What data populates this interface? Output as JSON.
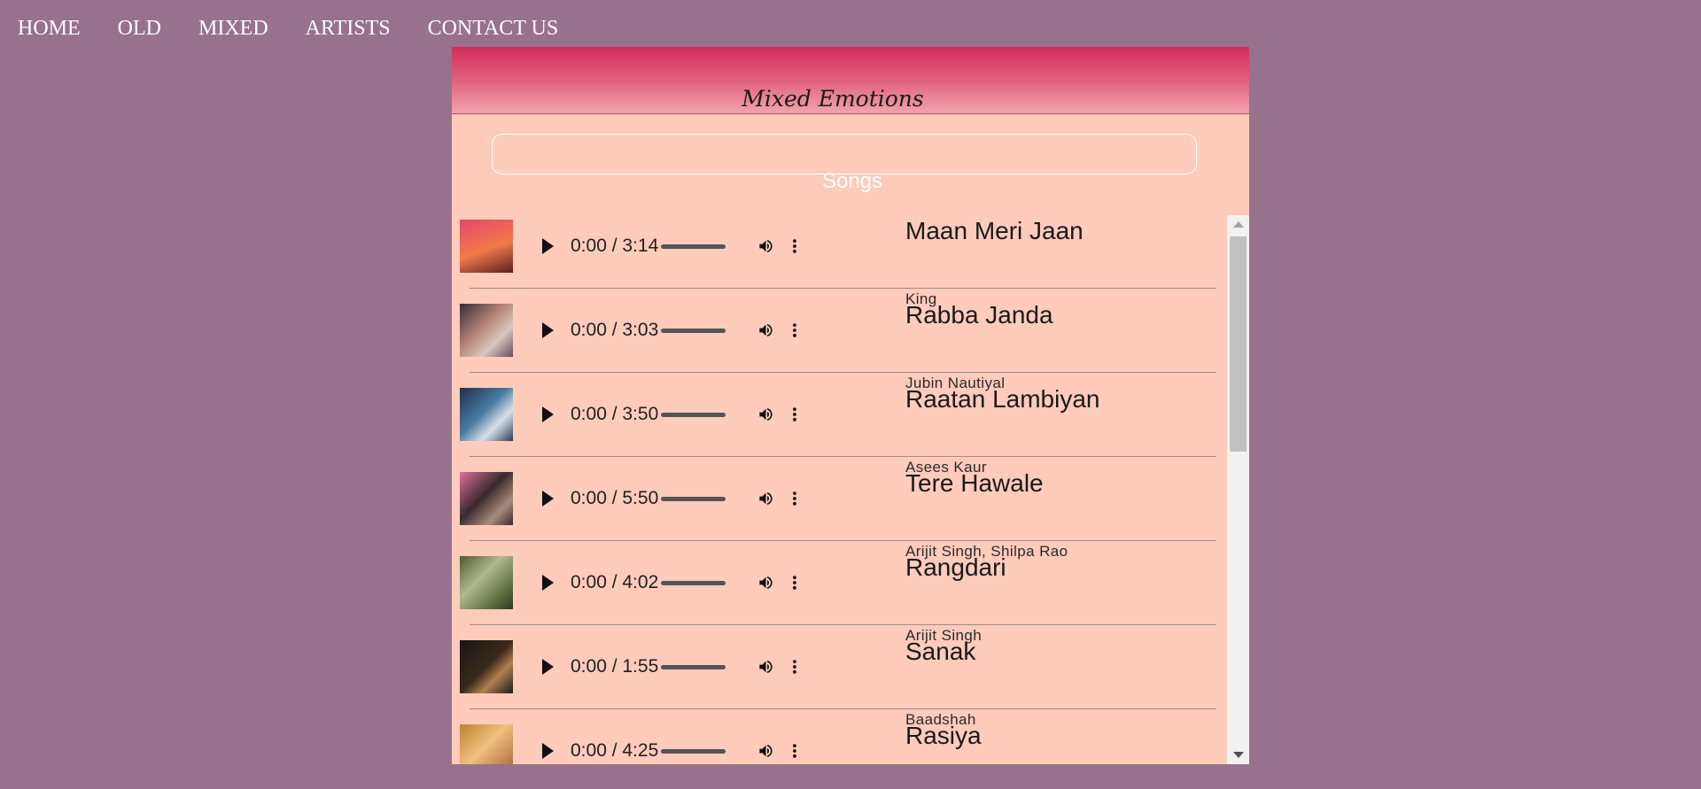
{
  "nav": {
    "items": [
      {
        "label": "HOME"
      },
      {
        "label": "OLD"
      },
      {
        "label": "MIXED"
      },
      {
        "label": "ARTISTS"
      },
      {
        "label": "CONTACT US"
      }
    ]
  },
  "page": {
    "title": "Mixed Emotions",
    "search_value": "",
    "songs_heading": "Songs"
  },
  "songs": [
    {
      "title": "Maan Meri Jaan",
      "artist": "King",
      "time": "0:00 / 3:14",
      "progress": 0
    },
    {
      "title": "Rabba Janda",
      "artist": "Jubin Nautiyal",
      "time": "0:00 / 3:03",
      "progress": 0
    },
    {
      "title": "Raatan Lambiyan",
      "artist": "Asees Kaur",
      "time": "0:00 / 3:50",
      "progress": 0
    },
    {
      "title": "Tere Hawale",
      "artist": "Arijit Singh, Shilpa Rao",
      "time": "0:00 / 5:50",
      "progress": 0
    },
    {
      "title": "Rangdari",
      "artist": "Arijit Singh",
      "time": "0:00 / 4:02",
      "progress": 0
    },
    {
      "title": "Sanak",
      "artist": "Baadshah",
      "time": "0:00 / 1:55",
      "progress": 0
    },
    {
      "title": "Rasiya",
      "artist": "",
      "time": "0:00 / 4:25",
      "progress": 0
    }
  ],
  "icons": {
    "play": "play-icon",
    "volume": "volume-icon",
    "more": "more-options-icon"
  },
  "colors": {
    "background": "#98718d",
    "panel": "#ffcbbb",
    "banner_top": "#d42d5f",
    "banner_bottom": "#f2a3b0"
  }
}
